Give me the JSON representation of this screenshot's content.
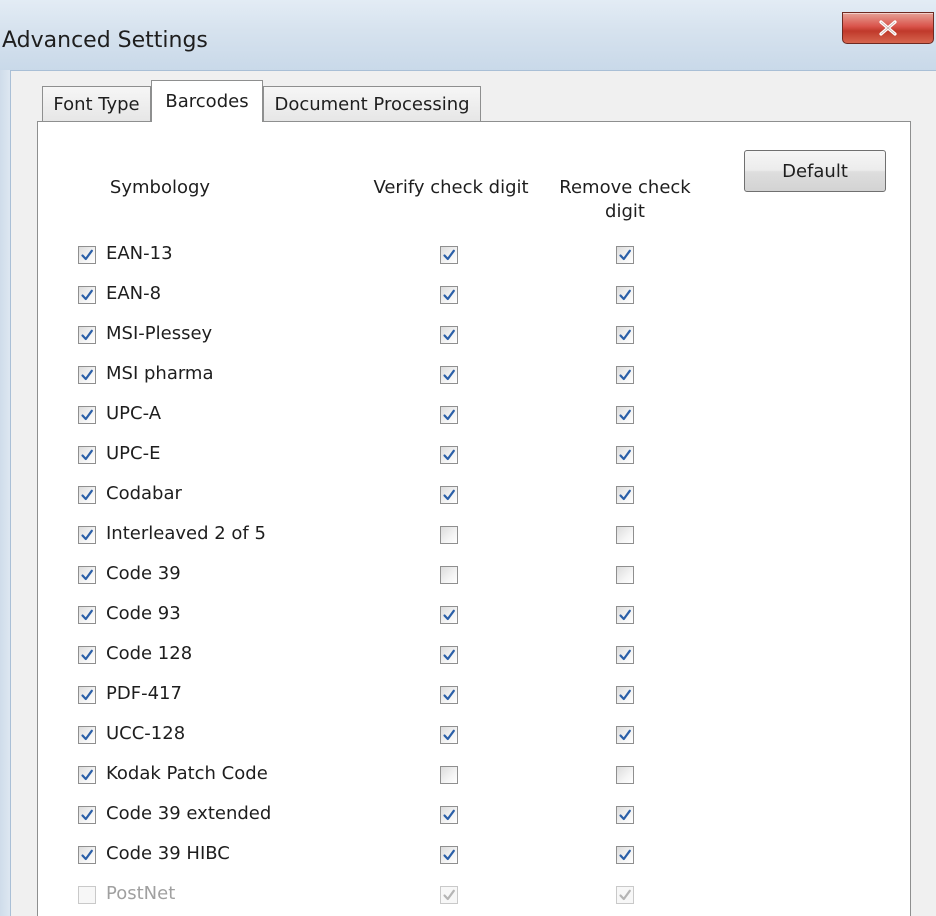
{
  "window": {
    "title": "Advanced Settings",
    "close_icon": "close-icon"
  },
  "tabs": [
    {
      "label": "Font Type",
      "active": false
    },
    {
      "label": "Barcodes",
      "active": true
    },
    {
      "label": "Document Processing",
      "active": false
    }
  ],
  "barcodes": {
    "default_button": "Default",
    "headers": {
      "symbology": "Symbology",
      "verify": "Verify check digit",
      "remove": "Remove check digit"
    },
    "rows": [
      {
        "label": "EAN-13",
        "enabled": true,
        "verify": true,
        "remove": true
      },
      {
        "label": "EAN-8",
        "enabled": true,
        "verify": true,
        "remove": true
      },
      {
        "label": "MSI-Plessey",
        "enabled": true,
        "verify": true,
        "remove": true
      },
      {
        "label": "MSI pharma",
        "enabled": true,
        "verify": true,
        "remove": true
      },
      {
        "label": "UPC-A",
        "enabled": true,
        "verify": true,
        "remove": true
      },
      {
        "label": "UPC-E",
        "enabled": true,
        "verify": true,
        "remove": true
      },
      {
        "label": "Codabar",
        "enabled": true,
        "verify": true,
        "remove": true
      },
      {
        "label": "Interleaved 2 of 5",
        "enabled": true,
        "verify": false,
        "remove": false
      },
      {
        "label": "Code 39",
        "enabled": true,
        "verify": false,
        "remove": false
      },
      {
        "label": "Code 93",
        "enabled": true,
        "verify": true,
        "remove": true
      },
      {
        "label": "Code 128",
        "enabled": true,
        "verify": true,
        "remove": true
      },
      {
        "label": "PDF-417",
        "enabled": true,
        "verify": true,
        "remove": true
      },
      {
        "label": "UCC-128",
        "enabled": true,
        "verify": true,
        "remove": true
      },
      {
        "label": "Kodak Patch Code",
        "enabled": true,
        "verify": false,
        "remove": false
      },
      {
        "label": "Code 39 extended",
        "enabled": true,
        "verify": true,
        "remove": true
      },
      {
        "label": "Code 39 HIBC",
        "enabled": true,
        "verify": true,
        "remove": true
      },
      {
        "label": "PostNet",
        "enabled": false,
        "verify": true,
        "remove": true,
        "disabled": true
      }
    ]
  },
  "colors": {
    "check_mark": "#2a5fa8",
    "titlebar": "#d6e2ee",
    "close_button": "#c9463a"
  }
}
